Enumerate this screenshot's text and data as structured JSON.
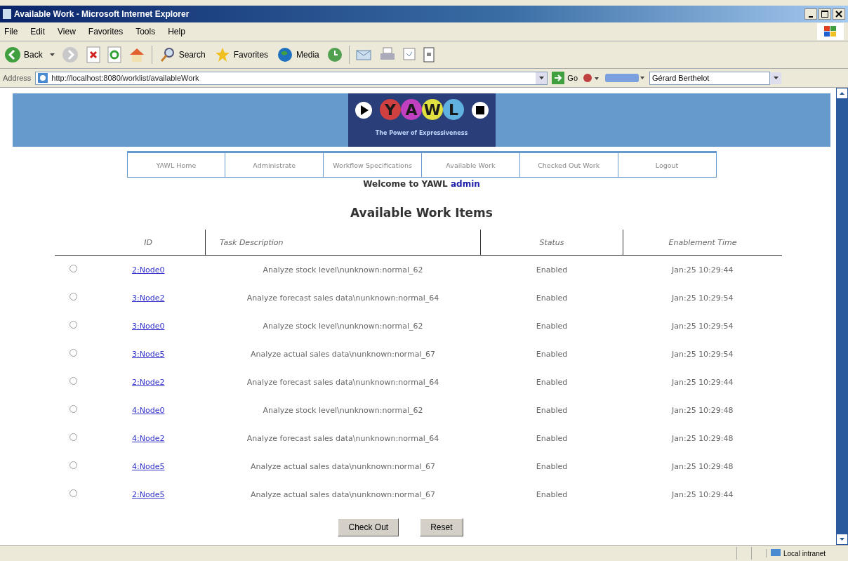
{
  "window": {
    "title": "Available Work - Microsoft Internet Explorer"
  },
  "menu": [
    "File",
    "Edit",
    "View",
    "Favorites",
    "Tools",
    "Help"
  ],
  "toolbar": {
    "back": "Back",
    "search": "Search",
    "favorites": "Favorites",
    "media": "Media"
  },
  "address_bar": {
    "label": "Address",
    "value": "http://localhost:8080/worklist/availableWork",
    "go": "Go",
    "search_value": "Gérard Berthelot"
  },
  "banner": {
    "logo_letters": [
      "Y",
      "A",
      "W",
      "L"
    ],
    "tagline": "The Power of Expressiveness"
  },
  "nav": [
    {
      "label": "YAWL Home"
    },
    {
      "label": "Administrate"
    },
    {
      "label": "Workflow Specifications"
    },
    {
      "label": "Available Work"
    },
    {
      "label": "Checked Out Work"
    },
    {
      "label": "Logout"
    }
  ],
  "welcome": {
    "text": "Welcome to YAWL",
    "user": "admin"
  },
  "heading": "Available Work Items",
  "table": {
    "columns": [
      "ID",
      "Task Description",
      "Status",
      "Enablement Time"
    ],
    "rows": [
      {
        "selected": false,
        "id": "2:Node0",
        "task": "Analyze stock level\\nunknown:normal_62",
        "status": "Enabled",
        "time": "Jan:25 10:29:44"
      },
      {
        "selected": false,
        "id": "3:Node2",
        "task": "Analyze forecast sales data\\nunknown:normal_64",
        "status": "Enabled",
        "time": "Jan:25 10:29:54"
      },
      {
        "selected": false,
        "id": "3:Node0",
        "task": "Analyze stock level\\nunknown:normal_62",
        "status": "Enabled",
        "time": "Jan:25 10:29:54"
      },
      {
        "selected": false,
        "id": "3:Node5",
        "task": "Analyze actual sales data\\nunknown:normal_67",
        "status": "Enabled",
        "time": "Jan:25 10:29:54"
      },
      {
        "selected": false,
        "id": "2:Node2",
        "task": "Analyze forecast sales data\\nunknown:normal_64",
        "status": "Enabled",
        "time": "Jan:25 10:29:44"
      },
      {
        "selected": false,
        "id": "4:Node0",
        "task": "Analyze stock level\\nunknown:normal_62",
        "status": "Enabled",
        "time": "Jan:25 10:29:48"
      },
      {
        "selected": false,
        "id": "4:Node2",
        "task": "Analyze forecast sales data\\nunknown:normal_64",
        "status": "Enabled",
        "time": "Jan:25 10:29:48"
      },
      {
        "selected": false,
        "id": "4:Node5",
        "task": "Analyze actual sales data\\nunknown:normal_67",
        "status": "Enabled",
        "time": "Jan:25 10:29:48"
      },
      {
        "selected": false,
        "id": "2:Node5",
        "task": "Analyze actual sales data\\nunknown:normal_67",
        "status": "Enabled",
        "time": "Jan:25 10:29:44"
      }
    ]
  },
  "buttons": [
    "Check Out",
    "Reset"
  ],
  "status_bar": {
    "zone": "Local intranet"
  }
}
